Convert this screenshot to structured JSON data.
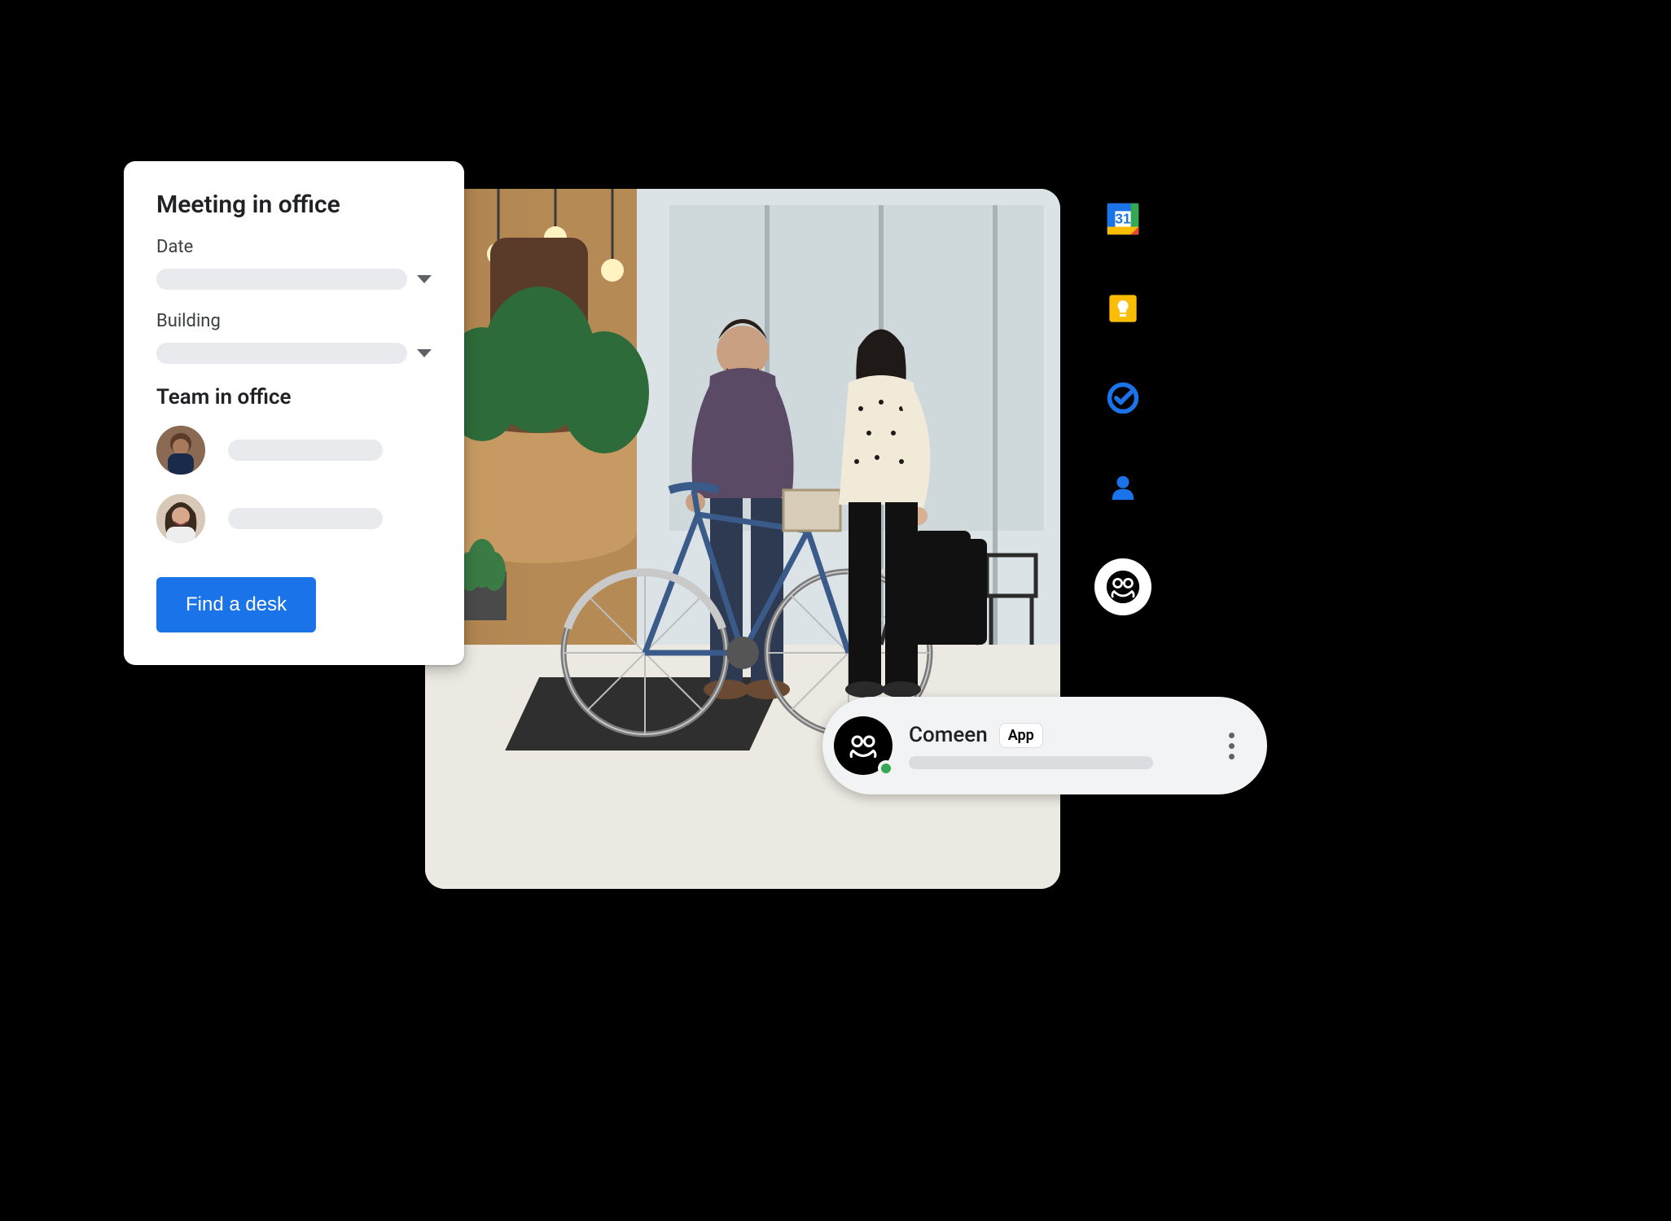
{
  "meeting_card": {
    "title": "Meeting in office",
    "date_label": "Date",
    "building_label": "Building",
    "team_section_title": "Team in office",
    "find_button_label": "Find a desk"
  },
  "chat": {
    "name": "Comeen",
    "badge": "App"
  },
  "sidebar": {
    "calendar_day": "31"
  }
}
